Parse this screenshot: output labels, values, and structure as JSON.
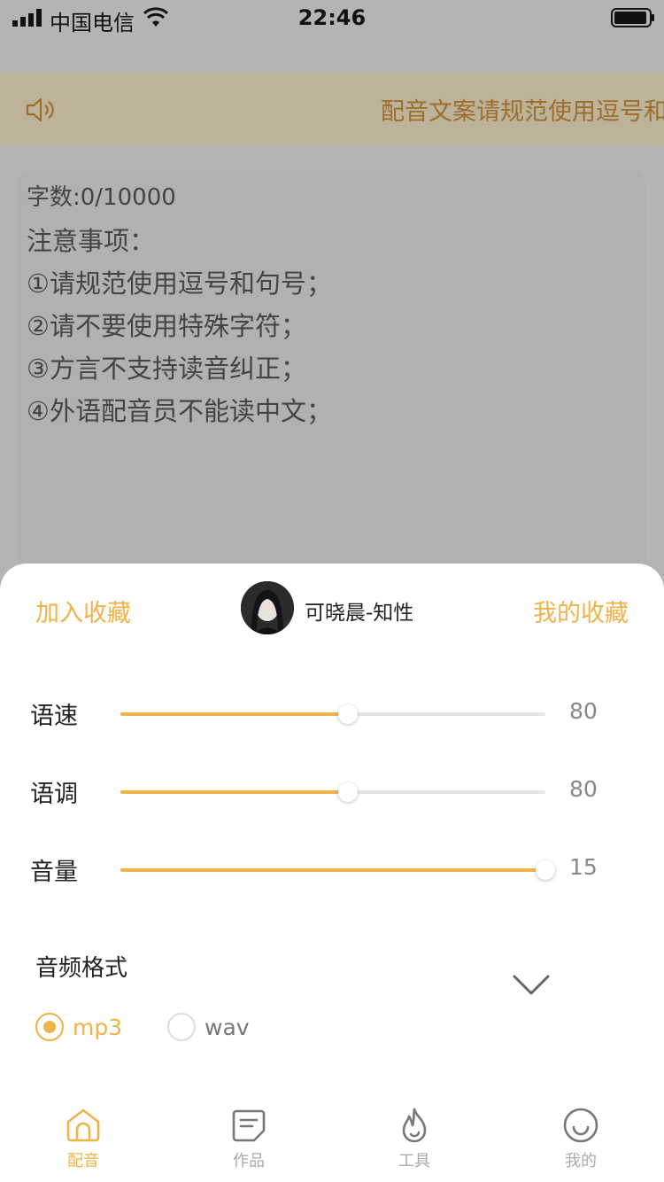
{
  "status_bar": {
    "carrier": "中国电信",
    "time": "22:46"
  },
  "notice": {
    "icon": "speaker-icon",
    "text": "配音文案请规范使用逗号和句号"
  },
  "editor": {
    "word_count": "字数:0/10000",
    "notes": [
      "注意事项：",
      "①请规范使用逗号和句号；",
      "②请不要使用特殊字符；",
      "③方言不支持读音纠正；",
      "④外语配音员不能读中文；"
    ]
  },
  "sheet": {
    "add_favorite": "加入收藏",
    "my_favorites": "我的收藏",
    "voice_name": "可晓晨-知性",
    "sliders": [
      {
        "label": "语速",
        "value": "80",
        "level": 0.535
      },
      {
        "label": "语调",
        "value": "80",
        "level": 0.535
      },
      {
        "label": "音量",
        "value": "15",
        "level": 1.0
      }
    ],
    "format_title": "音频格式",
    "formats": [
      {
        "label": "mp3",
        "selected": true
      },
      {
        "label": "wav",
        "selected": false
      }
    ]
  },
  "tabbar": {
    "tabs": [
      {
        "label": "配音",
        "icon": "home-icon",
        "active": true
      },
      {
        "label": "作品",
        "icon": "document-icon",
        "active": false
      },
      {
        "label": "工具",
        "icon": "flame-icon",
        "active": false
      },
      {
        "label": "我的",
        "icon": "smile-icon",
        "active": false
      }
    ]
  },
  "colors": {
    "accent": "#f0b34a",
    "overlay": "#b4b4b4",
    "notice_text": "#9c6e2b"
  }
}
